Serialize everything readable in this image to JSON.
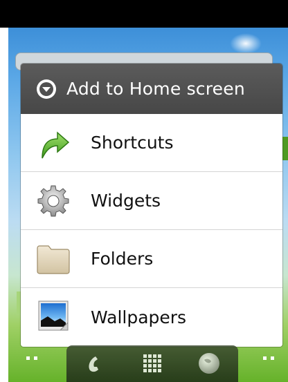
{
  "dialog": {
    "title": "Add to Home screen",
    "items": [
      {
        "label": "Shortcuts",
        "icon": "shortcut-arrow-icon"
      },
      {
        "label": "Widgets",
        "icon": "gear-icon"
      },
      {
        "label": "Folders",
        "icon": "folder-icon"
      },
      {
        "label": "Wallpapers",
        "icon": "wallpaper-picture-icon"
      }
    ]
  },
  "dock": {
    "items": [
      {
        "icon": "phone-icon"
      },
      {
        "icon": "app-drawer-grid-icon"
      },
      {
        "icon": "browser-globe-icon"
      }
    ]
  },
  "colors": {
    "header_bg": "#4f4f4f",
    "accent_green": "#5bb02e",
    "wallpaper_sky": "#5aa7e6",
    "wallpaper_grass": "#66b22a"
  }
}
